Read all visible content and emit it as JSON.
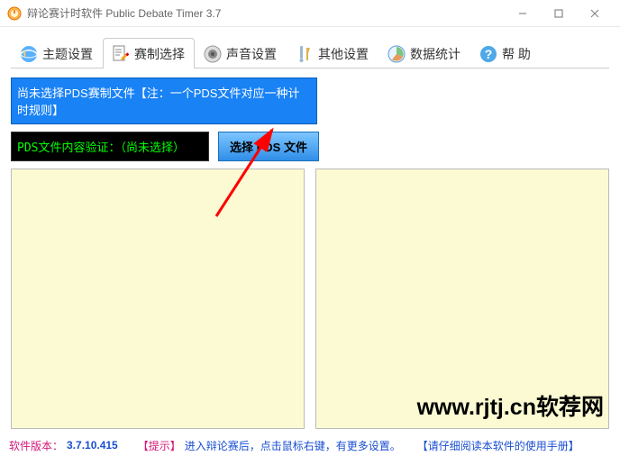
{
  "window": {
    "title": "辩论赛计时软件 Public Debate Timer 3.7"
  },
  "tabs": [
    {
      "label": "主题设置"
    },
    {
      "label": "赛制选择"
    },
    {
      "label": "声音设置"
    },
    {
      "label": "其他设置"
    },
    {
      "label": "数据统计"
    },
    {
      "label": "帮 助"
    }
  ],
  "notice": "尚未选择PDS赛制文件【注：一个PDS文件对应一种计时规则】",
  "verify": "PDS文件内容验证：（尚未选择）",
  "select_btn": "选择 PDS 文件",
  "footer": {
    "label": "软件版本：",
    "version": "3.7.10.415",
    "tip_open": "【提示】",
    "tip_text": "进入辩论赛后，点击鼠标右键，有更多设置。",
    "manual": "【请仔细阅读本软件的使用手册】"
  },
  "watermark": "www.rjtj.cn软荐网"
}
